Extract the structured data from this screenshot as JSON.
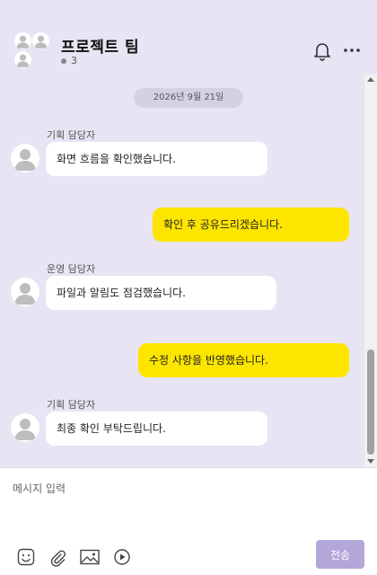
{
  "header": {
    "title": "프로젝트 팀",
    "member_count": "3",
    "icons": [
      "group-avatar-icon",
      "bell-icon",
      "more-icon"
    ]
  },
  "chat": {
    "date": "2026년 9월 21일",
    "messages": [
      {
        "direction": "in",
        "sender": "기획 담당자",
        "text": "화면 흐름을 확인했습니다."
      },
      {
        "direction": "out",
        "text": "확인 후 공유드리겠습니다."
      },
      {
        "direction": "in",
        "sender": "운영 담당자",
        "text": "파일과 알림도 점검했습니다."
      },
      {
        "direction": "out",
        "text": "수정 사항을 반영했습니다."
      },
      {
        "direction": "in",
        "sender": "기획 담당자",
        "text": "최종 확인 부탁드립니다."
      }
    ]
  },
  "composer": {
    "placeholder": "메시지 입력",
    "send_label": "전송",
    "tools": [
      "emoji-icon",
      "attach-icon",
      "image-icon",
      "video-icon"
    ]
  },
  "colors": {
    "background": "#e8e4f4",
    "incoming_bubble": "#ffffff",
    "outgoing_bubble": "#fee500",
    "send_button": "#b3a6d8"
  }
}
